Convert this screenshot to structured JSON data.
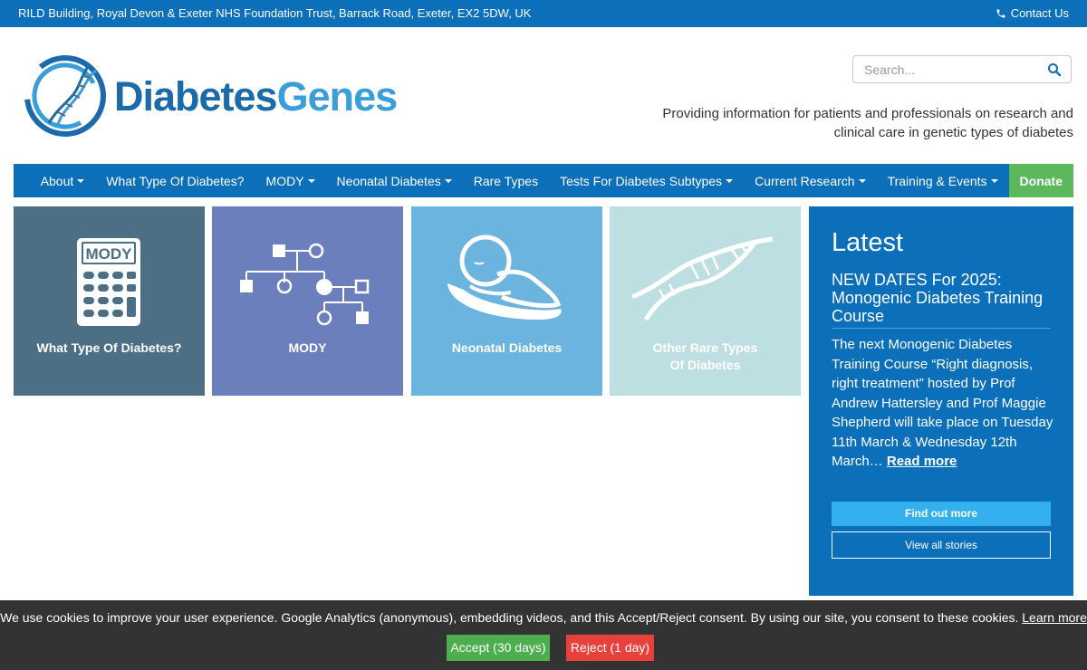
{
  "topbar": {
    "address": "RILD Building, Royal Devon & Exeter NHS Foundation Trust, Barrack Road, Exeter, EX2 5DW, UK",
    "contact_label": "Contact Us"
  },
  "header": {
    "logo_word1": "Diabetes",
    "logo_word2": "Genes",
    "search_placeholder": "Search...",
    "tagline": "Providing information for patients and professionals on research and clinical care in genetic types of diabetes"
  },
  "nav": {
    "items": [
      {
        "label": "About",
        "dropdown": true
      },
      {
        "label": "What Type Of Diabetes?",
        "dropdown": false
      },
      {
        "label": "MODY",
        "dropdown": true
      },
      {
        "label": "Neonatal Diabetes",
        "dropdown": true
      },
      {
        "label": "Rare Types",
        "dropdown": false
      },
      {
        "label": "Tests For Diabetes Subtypes",
        "dropdown": true
      },
      {
        "label": "Current Research",
        "dropdown": true
      },
      {
        "label": "Training & Events",
        "dropdown": true
      }
    ],
    "donate_label": "Donate"
  },
  "tiles": [
    {
      "label": "What Type Of Diabetes?",
      "icon_text": "MODY",
      "icon": "calculator-icon",
      "color": "#4c6f86"
    },
    {
      "label": "MODY",
      "icon": "pedigree-icon",
      "color": "#6b7fbd"
    },
    {
      "label": "Neonatal Diabetes",
      "icon": "baby-icon",
      "color": "#6cb4e0"
    },
    {
      "label_line1": "Other Rare Types",
      "label_line2": "Of Diabetes",
      "icon": "dna-icon",
      "color": "#bedfe2"
    }
  ],
  "latest": {
    "heading": "Latest",
    "news_title": "NEW DATES For 2025: Monogenic Diabetes Training Course",
    "news_body": "The next Monogenic Diabetes Training Course “Right diagnosis, right treatment” hosted by Prof Andrew Hattersley and Prof Maggie Shepherd will take place on Tuesday 11th March & Wednesday 12th March…",
    "read_more": "Read more",
    "find_out_more": "Find out more",
    "view_all": "View all stories"
  },
  "cookie": {
    "message": "We use cookies to improve your user experience. Google Analytics (anonymous), embedding videos, and this Accept/Reject consent. By using our site, you consent to these cookies.",
    "learn_more": "Learn more",
    "accept": "Accept (30 days)",
    "reject": "Reject (1 day)"
  },
  "colors": {
    "brand_blue": "#0b6fba",
    "donate_green": "#5cb85c",
    "accept_green": "#4cae4c",
    "reject_red": "#e8413b",
    "find_button": "#35b0ee"
  }
}
